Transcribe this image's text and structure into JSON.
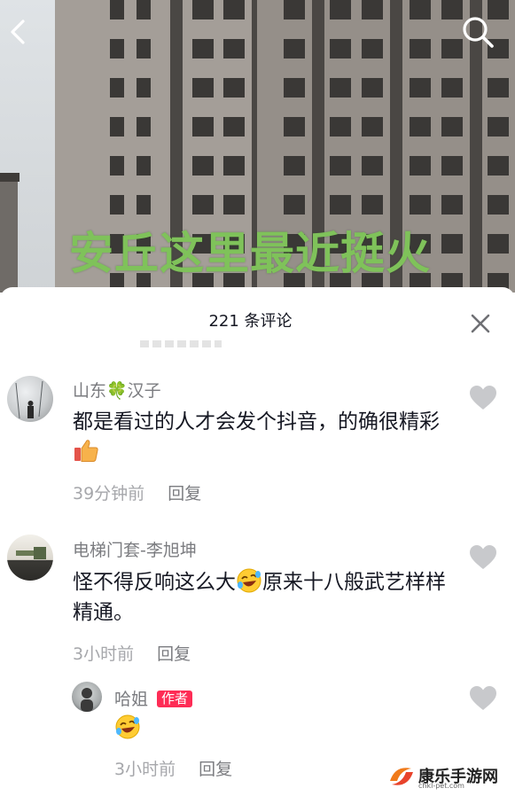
{
  "video": {
    "overlay_caption": "安丘这里最近挺火"
  },
  "comments_panel": {
    "title": "221 条评论",
    "comments": [
      {
        "author": "山东🍀汉子",
        "text": "都是看过的人才会发个抖音，的确很精彩",
        "emoji": "thumbs-up",
        "time": "39分钟前",
        "reply_label": "回复"
      },
      {
        "author": "电梯门套-李旭坤",
        "text_before": "怪不得反响这么大",
        "text_after": "原来十八般武艺样样精通。",
        "emoji": "rofl",
        "time": "3小时前",
        "reply_label": "回复"
      }
    ],
    "reply": {
      "author": "哈姐",
      "badge": "作者",
      "emoji": "rofl",
      "time": "3小时前",
      "reply_label": "回复"
    }
  },
  "watermark": {
    "brand": "康乐手游网",
    "domain": "chkl-pet.com"
  },
  "colors": {
    "accent": "#fe2c55",
    "caption_green": "#7fc25a"
  }
}
